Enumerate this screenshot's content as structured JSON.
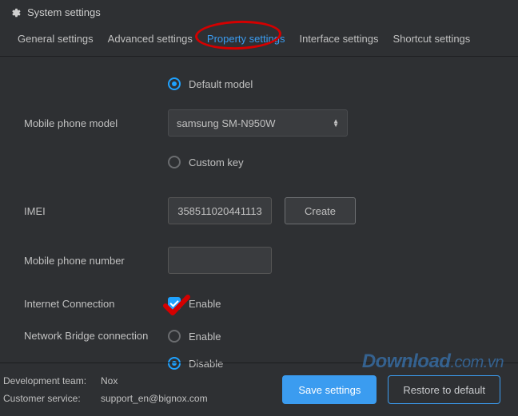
{
  "window": {
    "title": "System settings"
  },
  "tabs": {
    "general": "General settings",
    "advanced": "Advanced settings",
    "property": "Property settings",
    "interface": "Interface settings",
    "shortcut": "Shortcut settings"
  },
  "labels": {
    "mobile_phone_model": "Mobile phone model",
    "imei": "IMEI",
    "mobile_phone_number": "Mobile phone number",
    "internet_connection": "Internet Connection",
    "network_bridge": "Network Bridge connection"
  },
  "radios": {
    "default_model": "Default model",
    "custom_key": "Custom key",
    "enable": "Enable",
    "disable": "Disable"
  },
  "model_select": {
    "value": "samsung SM-N950W"
  },
  "imei_field": {
    "value": "358511020441113"
  },
  "phone_field": {
    "value": ""
  },
  "buttons": {
    "create": "Create",
    "save": "Save settings",
    "restore": "Restore to default"
  },
  "footer": {
    "dev_label": "Development team:",
    "dev_value": "Nox",
    "cs_label": "Customer service:",
    "cs_value": "support_en@bignox.com"
  },
  "watermark": {
    "main": "Download",
    "suffix": ".com.vn"
  }
}
